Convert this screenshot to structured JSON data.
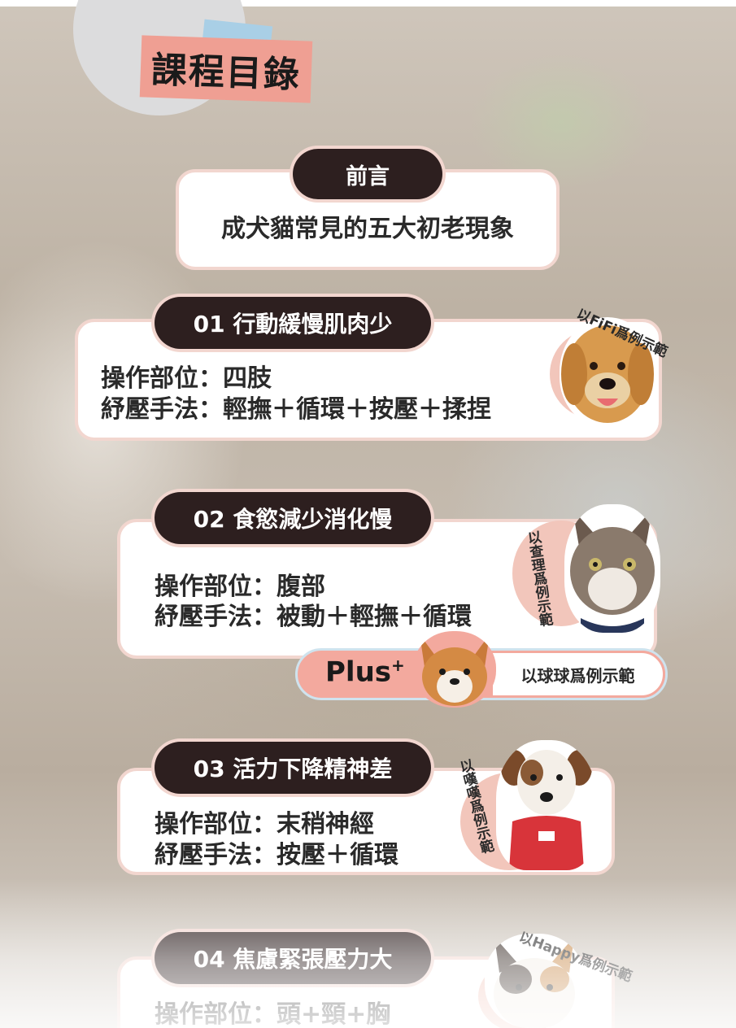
{
  "title": "課程目錄",
  "intro": {
    "tag": "前言",
    "text": "成犬貓常見的五大初老現象"
  },
  "sections": [
    {
      "tag": "01 行動緩慢肌肉少",
      "part_label": "操作部位：四肢",
      "method_label": "紓壓手法：輕撫＋循環＋按壓＋揉捏",
      "pet_caption": "以FiFi爲例示範"
    },
    {
      "tag": "02 食慾減少消化慢",
      "part_label": "操作部位：腹部",
      "method_label": "紓壓手法：被動＋輕撫＋循環",
      "pet_caption": "以查理爲例示範"
    },
    {
      "tag": "03 活力下降精神差",
      "part_label": "操作部位：末稍神經",
      "method_label": "紓壓手法：按壓＋循環",
      "pet_caption": "以嘆嘆爲例示範"
    },
    {
      "tag": "04 焦慮緊張壓力大",
      "part_label": "操作部位：頭+頸+胸",
      "pet_caption": "以Happy爲例示範"
    }
  ],
  "plus": {
    "label": "Plus",
    "sup": "+",
    "caption": "以球球爲例示範"
  },
  "colors": {
    "pill_dark": "#2d1f1f",
    "accent_pink": "#ef9f93",
    "card_border": "#f2d6cf",
    "tape_blue": "#a9cfe6"
  }
}
